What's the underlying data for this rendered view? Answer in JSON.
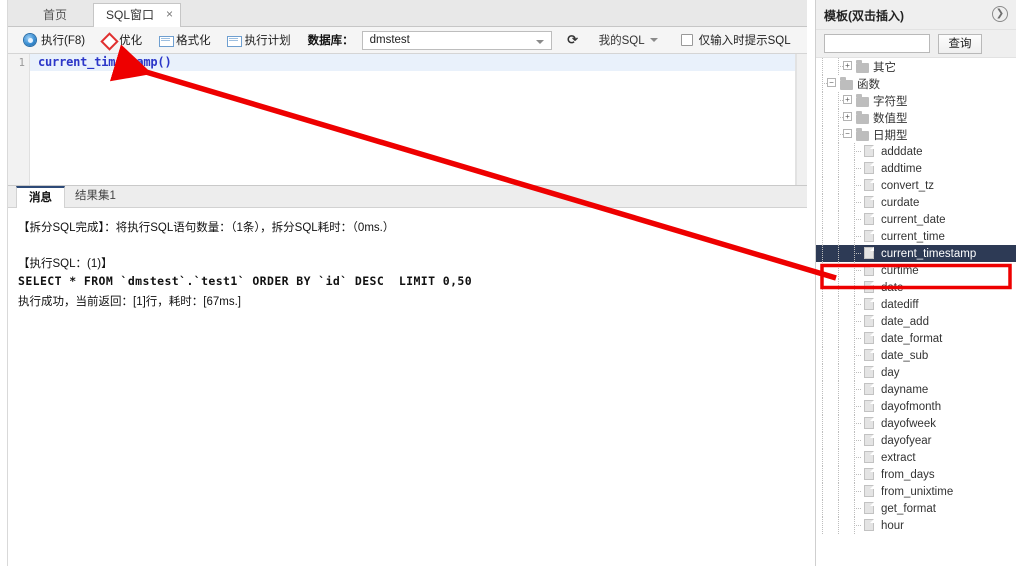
{
  "window": {
    "tabs": [
      {
        "label": "首页",
        "active": false,
        "closable": false
      },
      {
        "label": "SQL窗口",
        "active": true,
        "closable": true,
        "close_glyph": "×"
      }
    ]
  },
  "toolbar": {
    "execute_label": "执行(F8)",
    "optimize_label": "优化",
    "format_label": "格式化",
    "plan_label": "执行计划",
    "database_label": "数据库：",
    "database_value": "dmstest",
    "refresh_glyph": "⟳",
    "mysql_label": "我的SQL",
    "hint_checkbox_label": "仅输入时提示SQL",
    "hint_checkbox_checked": false
  },
  "editor": {
    "line_number": "1",
    "code": "current_timestamp()",
    "code_color": "#2b36c8"
  },
  "results": {
    "tabs": [
      {
        "label": "消息",
        "active": true
      },
      {
        "label": "结果集1",
        "active": false
      }
    ],
    "messages": [
      "【拆分SQL完成】：将执行SQL语句数量：（1条），拆分SQL耗时：（0ms.）",
      "【执行SQL：(1)】",
      "SELECT * FROM `dmstest`.`test1` ORDER BY `id` DESC  LIMIT 0,50",
      "执行成功，当前返回：[1]行，耗时：[67ms.]"
    ]
  },
  "template_panel": {
    "title": "模板(双击插入)",
    "collapse_glyph": "❯",
    "search_value": "",
    "search_placeholder": "",
    "search_button": "查询",
    "tree": [
      {
        "label": "其它",
        "depth": 1,
        "type": "folder",
        "toggle": "+",
        "selected": false
      },
      {
        "label": "函数",
        "depth": 0,
        "type": "folder",
        "toggle": "−",
        "selected": false
      },
      {
        "label": "字符型",
        "depth": 1,
        "type": "folder",
        "toggle": "+",
        "selected": false
      },
      {
        "label": "数值型",
        "depth": 1,
        "type": "folder",
        "toggle": "+",
        "selected": false
      },
      {
        "label": "日期型",
        "depth": 1,
        "type": "folder",
        "toggle": "−",
        "selected": false
      },
      {
        "label": "adddate",
        "depth": 2,
        "type": "doc",
        "toggle": "",
        "selected": false
      },
      {
        "label": "addtime",
        "depth": 2,
        "type": "doc",
        "toggle": "",
        "selected": false
      },
      {
        "label": "convert_tz",
        "depth": 2,
        "type": "doc",
        "toggle": "",
        "selected": false
      },
      {
        "label": "curdate",
        "depth": 2,
        "type": "doc",
        "toggle": "",
        "selected": false
      },
      {
        "label": "current_date",
        "depth": 2,
        "type": "doc",
        "toggle": "",
        "selected": false
      },
      {
        "label": "current_time",
        "depth": 2,
        "type": "doc",
        "toggle": "",
        "selected": false
      },
      {
        "label": "current_timestamp",
        "depth": 2,
        "type": "doc",
        "toggle": "",
        "selected": true
      },
      {
        "label": "curtime",
        "depth": 2,
        "type": "doc",
        "toggle": "",
        "selected": false
      },
      {
        "label": "date",
        "depth": 2,
        "type": "doc",
        "toggle": "",
        "selected": false
      },
      {
        "label": "datediff",
        "depth": 2,
        "type": "doc",
        "toggle": "",
        "selected": false
      },
      {
        "label": "date_add",
        "depth": 2,
        "type": "doc",
        "toggle": "",
        "selected": false
      },
      {
        "label": "date_format",
        "depth": 2,
        "type": "doc",
        "toggle": "",
        "selected": false
      },
      {
        "label": "date_sub",
        "depth": 2,
        "type": "doc",
        "toggle": "",
        "selected": false
      },
      {
        "label": "day",
        "depth": 2,
        "type": "doc",
        "toggle": "",
        "selected": false
      },
      {
        "label": "dayname",
        "depth": 2,
        "type": "doc",
        "toggle": "",
        "selected": false
      },
      {
        "label": "dayofmonth",
        "depth": 2,
        "type": "doc",
        "toggle": "",
        "selected": false
      },
      {
        "label": "dayofweek",
        "depth": 2,
        "type": "doc",
        "toggle": "",
        "selected": false
      },
      {
        "label": "dayofyear",
        "depth": 2,
        "type": "doc",
        "toggle": "",
        "selected": false
      },
      {
        "label": "extract",
        "depth": 2,
        "type": "doc",
        "toggle": "",
        "selected": false
      },
      {
        "label": "from_days",
        "depth": 2,
        "type": "doc",
        "toggle": "",
        "selected": false
      },
      {
        "label": "from_unixtime",
        "depth": 2,
        "type": "doc",
        "toggle": "",
        "selected": false
      },
      {
        "label": "get_format",
        "depth": 2,
        "type": "doc",
        "toggle": "",
        "selected": false
      },
      {
        "label": "hour",
        "depth": 2,
        "type": "doc",
        "toggle": "",
        "selected": false
      }
    ]
  },
  "annotations": {
    "arrow_color": "#ee0000",
    "highlight_box_color": "#ee0000",
    "selection_color": "#2d3a55"
  }
}
